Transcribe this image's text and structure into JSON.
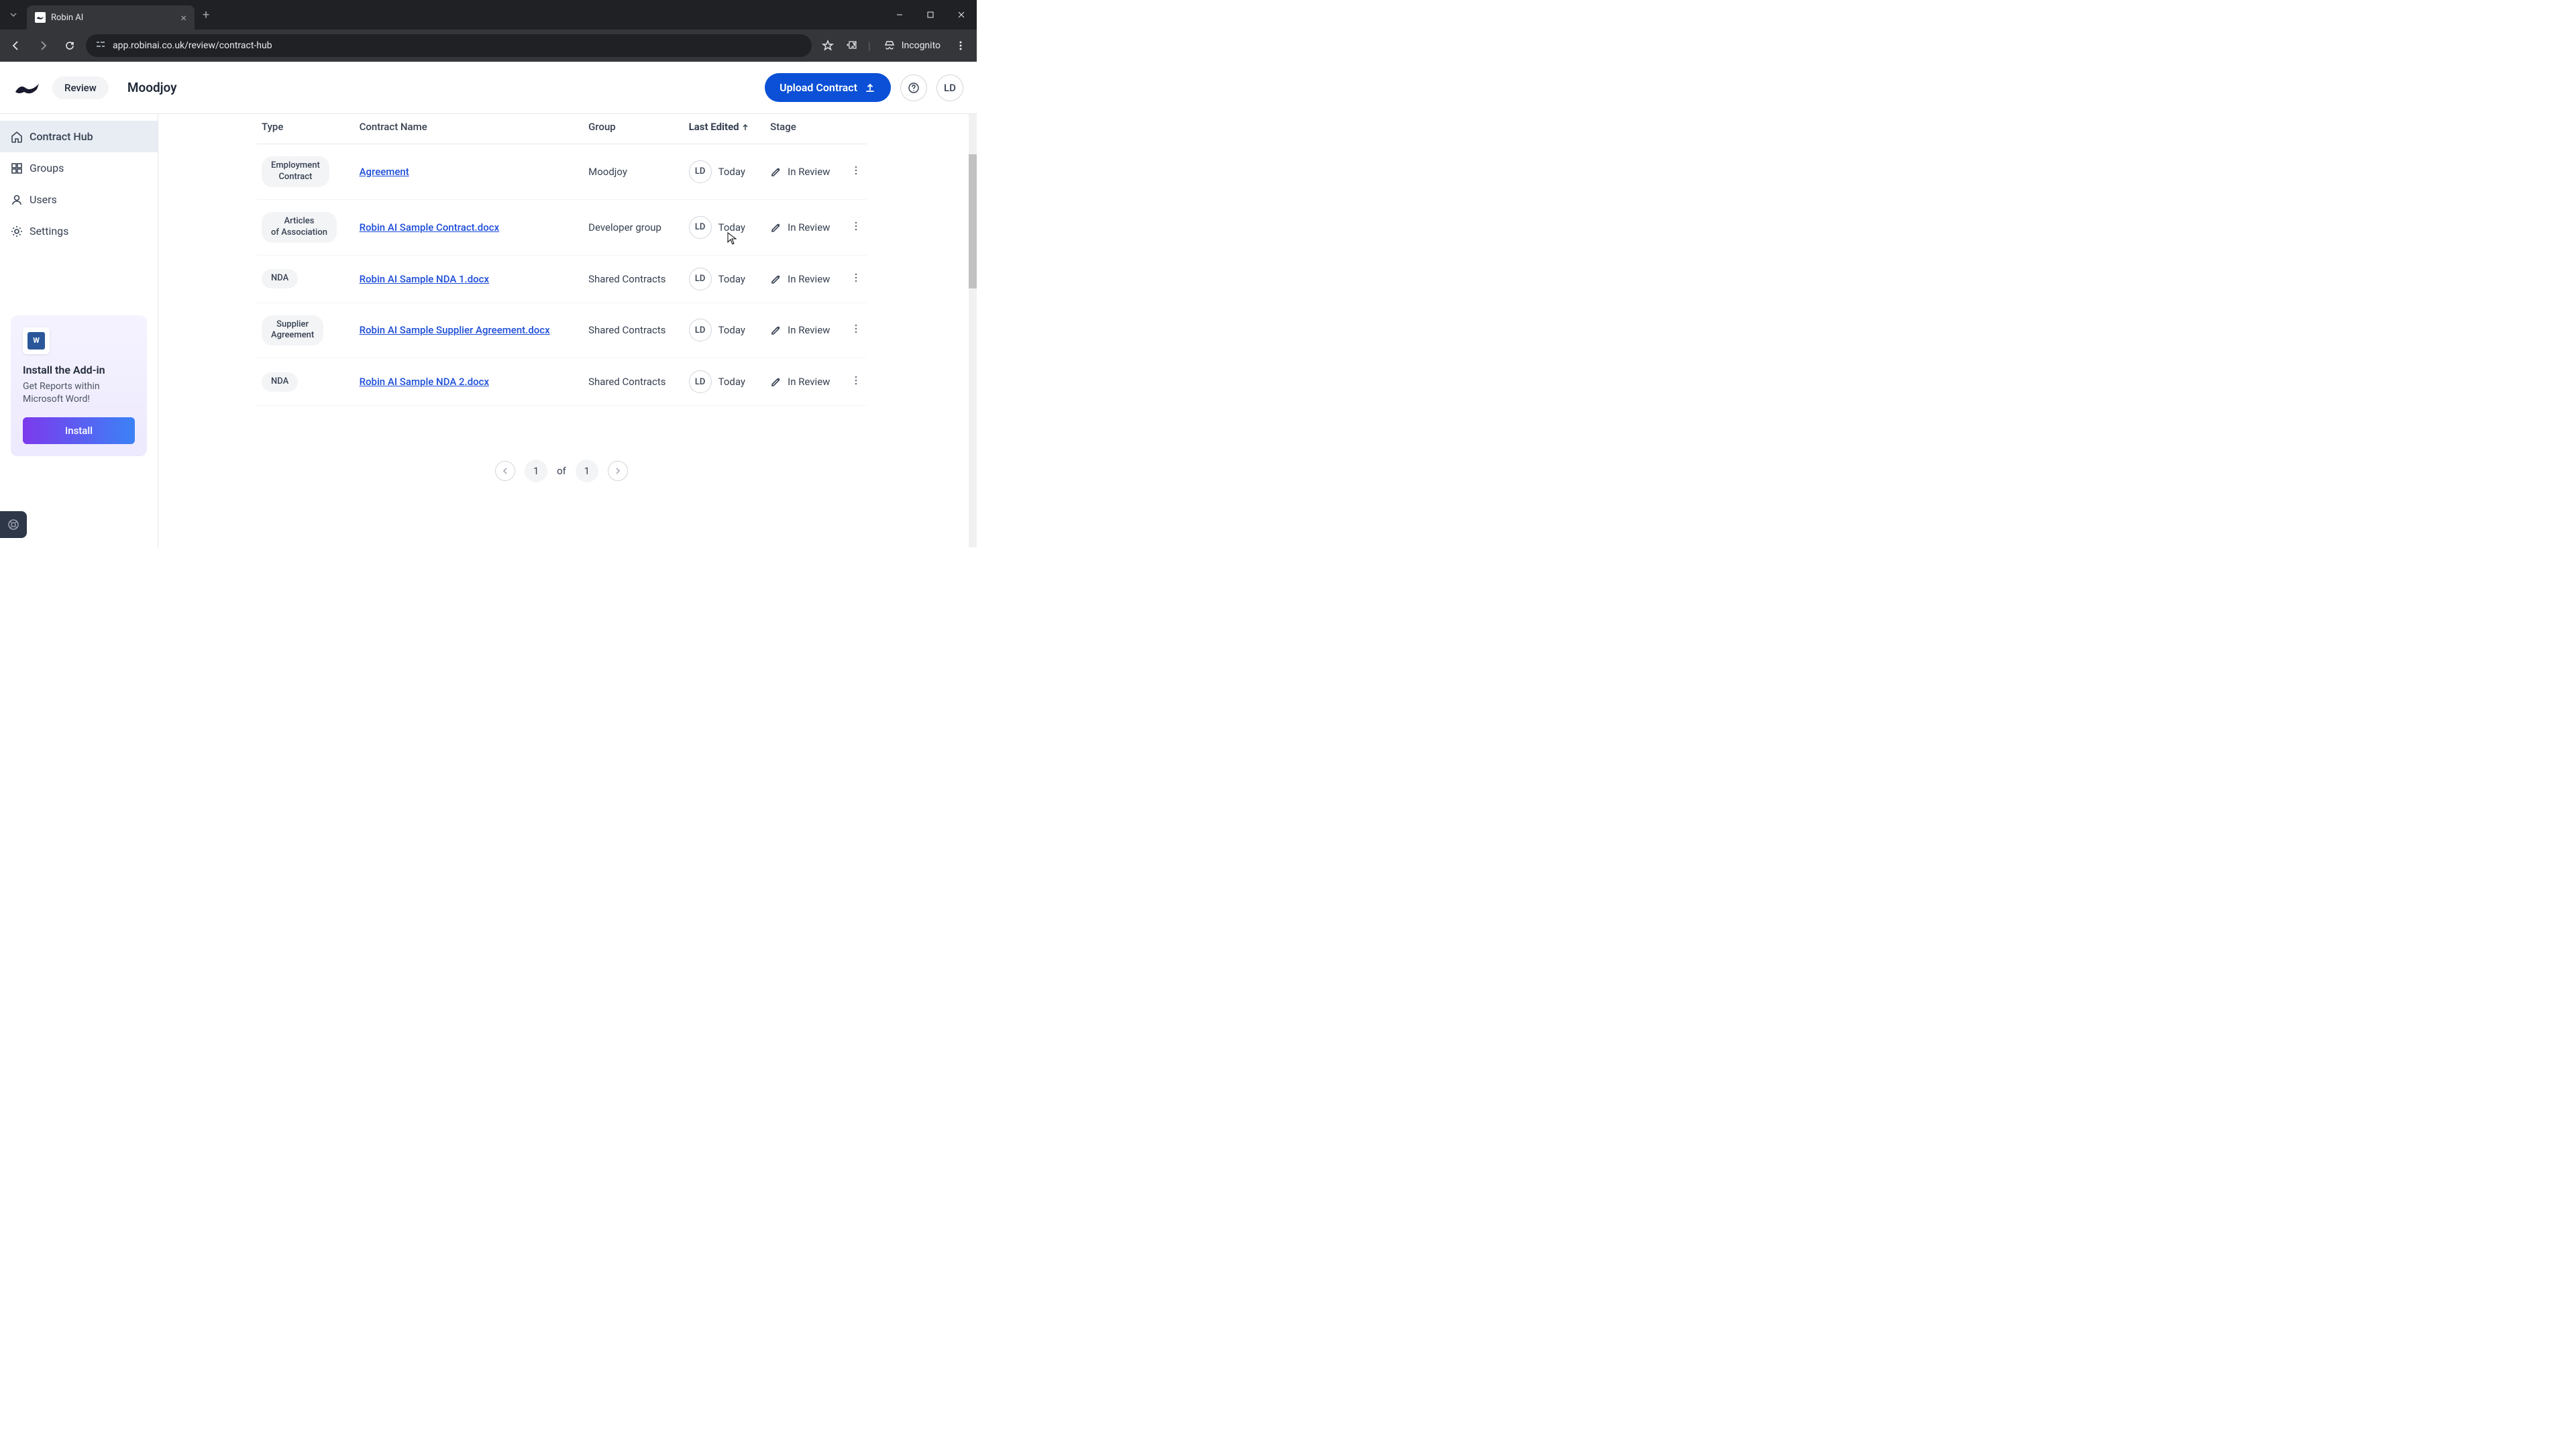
{
  "browser": {
    "tab_title": "Robin AI",
    "url": "app.robinai.co.uk/review/contract-hub",
    "incognito_label": "Incognito"
  },
  "header": {
    "review_label": "Review",
    "org_name": "Moodjoy",
    "upload_label": "Upload Contract",
    "user_initials": "LD"
  },
  "sidebar": {
    "items": [
      {
        "label": "Contract Hub"
      },
      {
        "label": "Groups"
      },
      {
        "label": "Users"
      },
      {
        "label": "Settings"
      }
    ],
    "addin": {
      "title": "Install the Add-in",
      "desc": "Get Reports within Microsoft Word!",
      "button": "Install"
    }
  },
  "table": {
    "columns": {
      "type": "Type",
      "name": "Contract Name",
      "group": "Group",
      "edited": "Last Edited",
      "stage": "Stage"
    },
    "rows": [
      {
        "type": "Employment Contract",
        "name": "Agreement",
        "group": "Moodjoy",
        "editor": "LD",
        "edited": "Today",
        "stage": "In Review"
      },
      {
        "type": "Articles of Association",
        "name": "Robin AI Sample Contract.docx",
        "group": "Developer group",
        "editor": "LD",
        "edited": "Today",
        "stage": "In Review"
      },
      {
        "type": "NDA",
        "name": "Robin AI Sample NDA 1.docx",
        "group": "Shared Contracts",
        "editor": "LD",
        "edited": "Today",
        "stage": "In Review"
      },
      {
        "type": "Supplier Agreement",
        "name": "Robin AI Sample Supplier Agreement.docx",
        "group": "Shared Contracts",
        "editor": "LD",
        "edited": "Today",
        "stage": "In Review"
      },
      {
        "type": "NDA",
        "name": "Robin AI Sample NDA 2.docx",
        "group": "Shared Contracts",
        "editor": "LD",
        "edited": "Today",
        "stage": "In Review"
      }
    ]
  },
  "pagination": {
    "current": "1",
    "of_label": "of",
    "total": "1"
  }
}
